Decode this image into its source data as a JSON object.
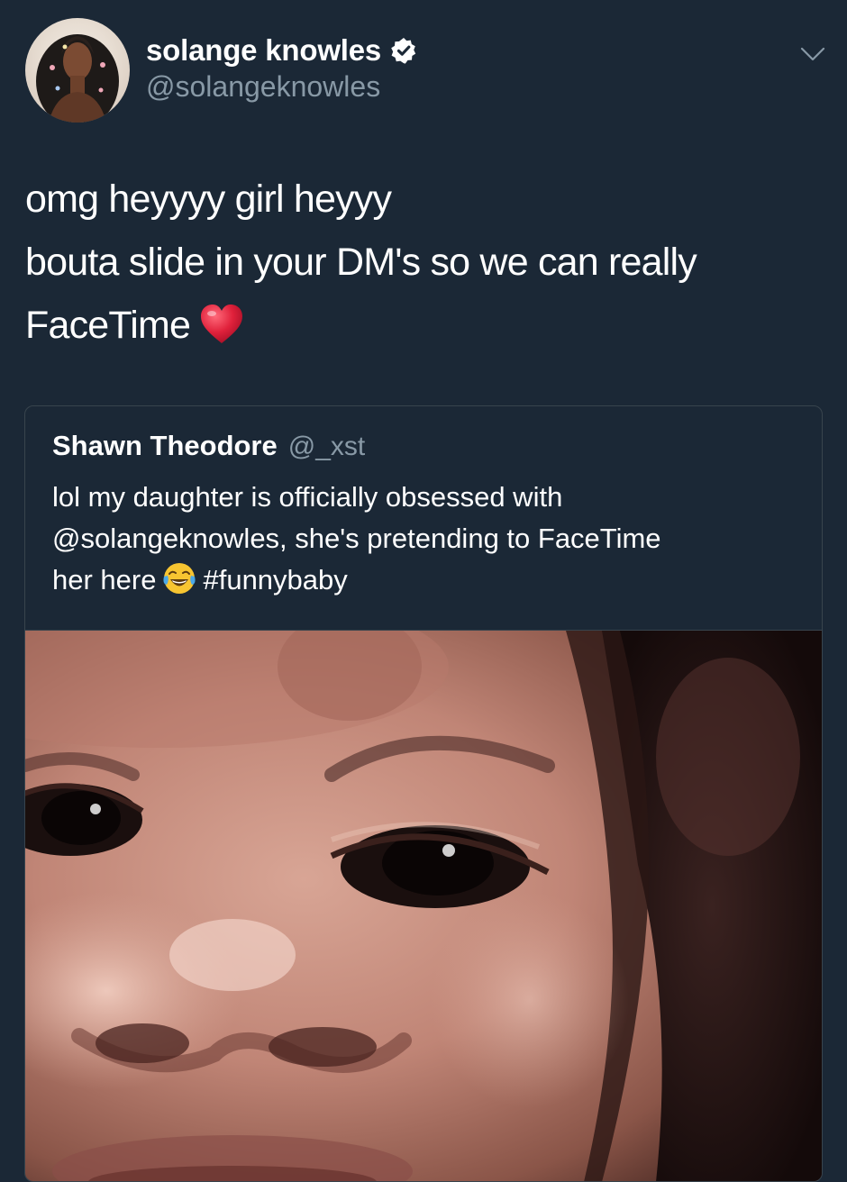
{
  "tweet": {
    "display_name": "solange knowles",
    "handle": "@solangeknowles",
    "text_lines": [
      "omg heyyyy girl heyyy",
      "bouta slide in your DM's so we can really",
      "FaceTime"
    ],
    "icons": {
      "verified": "verified-badge-icon",
      "menu": "chevron-down-icon",
      "emoji": "red-heart-icon"
    }
  },
  "quoted_tweet": {
    "display_name": "Shawn Theodore",
    "handle": "@_xst",
    "text_lines": [
      "lol my daughter is officially obsessed with",
      "@solangeknowles, she's pretending to FaceTime",
      "her here"
    ],
    "hashtag": "#funnybaby",
    "emoji": "face-with-tears-of-joy-icon"
  },
  "colors": {
    "background": "#1b2836",
    "secondary_text": "#8899a6",
    "border": "#38444d",
    "heart": "#e0213b"
  }
}
